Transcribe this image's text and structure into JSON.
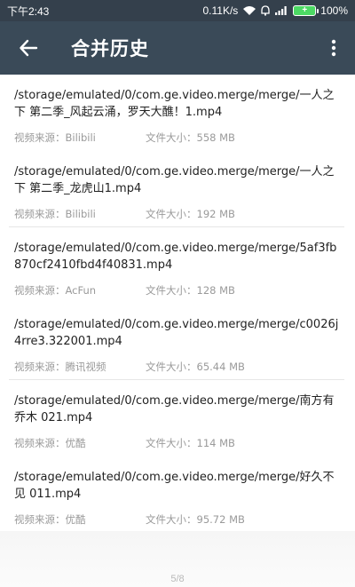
{
  "status_bar": {
    "time": "下午2:43",
    "speed": "0.11K/s",
    "battery": "100%"
  },
  "app_bar": {
    "title": "合并历史",
    "back_icon": "arrow-left-icon",
    "menu_icon": "more-vertical-icon"
  },
  "labels": {
    "source_prefix": "视频来源：",
    "size_prefix": "文件大小："
  },
  "items": [
    {
      "path": "/storage/emulated/0/com.ge.video.merge/merge/一人之下 第二季_风起云涌，罗天大醮！1.mp4",
      "source": "视频来源：Bilibili",
      "size": "文件大小：558 MB"
    },
    {
      "path": "/storage/emulated/0/com.ge.video.merge/merge/一人之下 第二季_龙虎山1.mp4",
      "source": "视频来源：Bilibili",
      "size": "文件大小：192 MB"
    },
    {
      "path": "/storage/emulated/0/com.ge.video.merge/merge/5af3fb870cf2410fbd4f40831.mp4",
      "source": "视频来源：AcFun",
      "size": "文件大小：128 MB"
    },
    {
      "path": "/storage/emulated/0/com.ge.video.merge/merge/c0026j4rre3.322001.mp4",
      "source": "视频来源：腾讯视频",
      "size": "文件大小：65.44 MB"
    },
    {
      "path": "/storage/emulated/0/com.ge.video.merge/merge/南方有乔木 021.mp4",
      "source": "视频来源：优酷",
      "size": "文件大小：114 MB"
    },
    {
      "path": "/storage/emulated/0/com.ge.video.merge/merge/好久不见 011.mp4",
      "source": "视频来源：优酷",
      "size": "文件大小：95.72 MB"
    }
  ],
  "footer": {
    "page": "5/8"
  },
  "colors": {
    "app_bar": "#3a4a58",
    "status_bar": "#34404c",
    "battery": "#4cd964"
  }
}
